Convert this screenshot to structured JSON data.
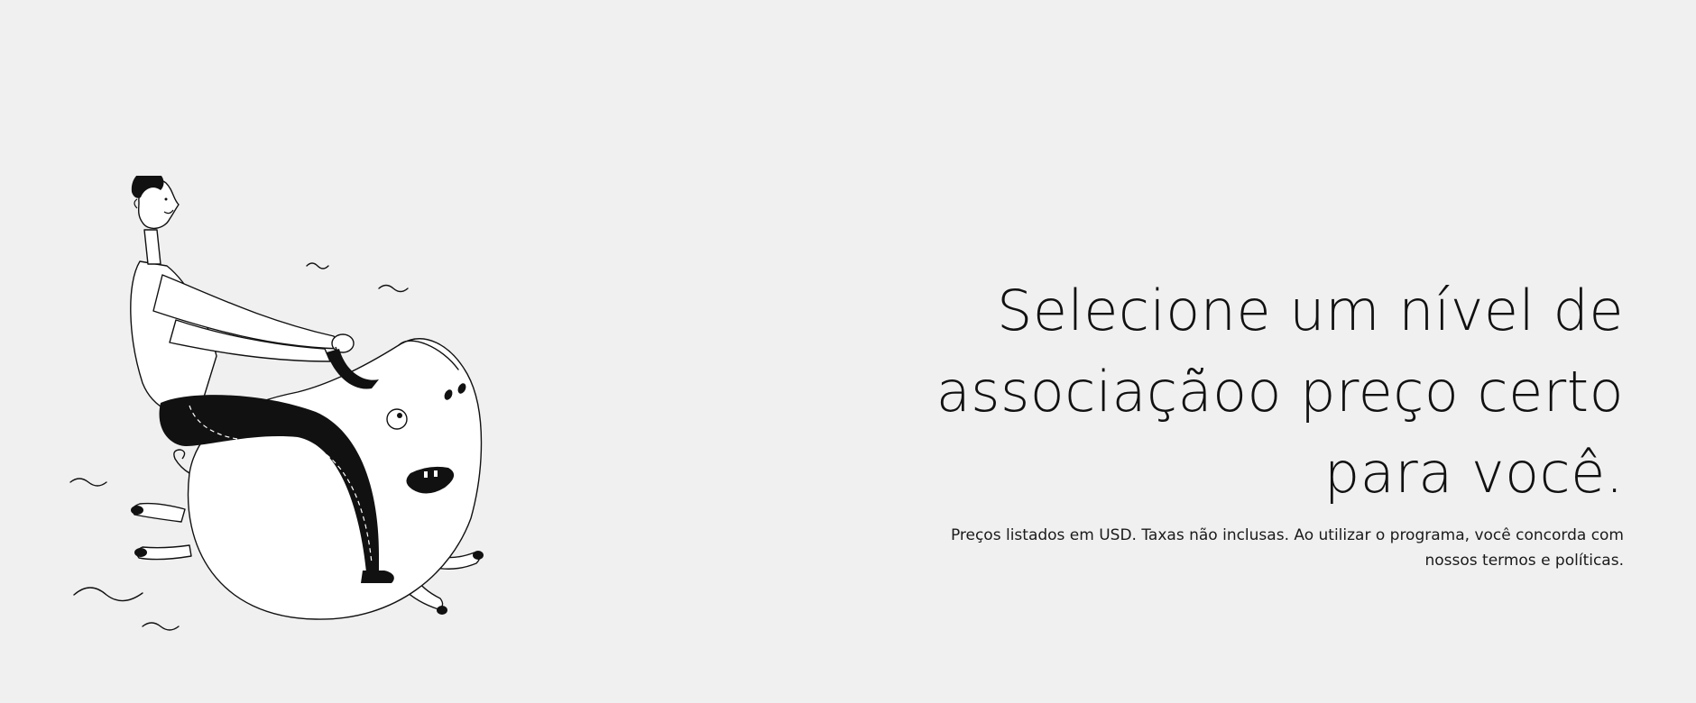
{
  "hero": {
    "headline_lines": [
      "Selecione um nível de",
      "associaçãoo preço certo",
      "para você."
    ],
    "disclaimer_lines": [
      "Preços listados em USD. Taxas não inclusas. Ao utilizar o programa, você concorda com",
      "nossos termos e políticas."
    ]
  },
  "illustration": {
    "icon": "man-riding-pig-illustration",
    "stroke_color": "#111111",
    "fill_color": "#ffffff",
    "background_color": "#f0f0f0"
  }
}
